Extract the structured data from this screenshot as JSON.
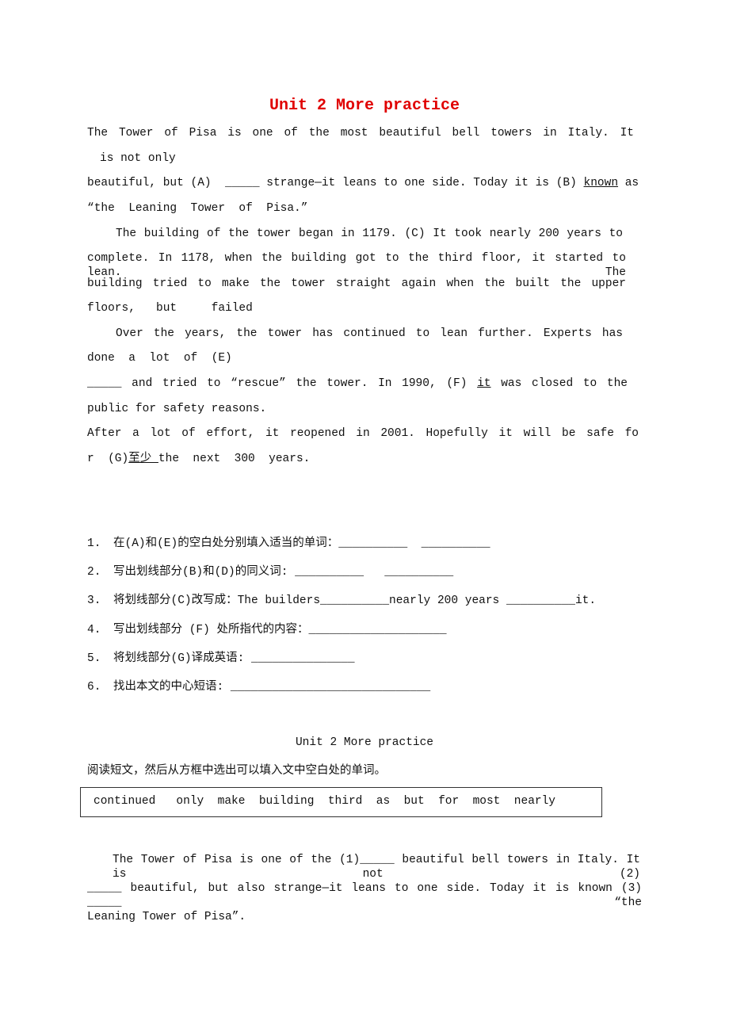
{
  "title": "Unit 2 More practice",
  "passage": [
    [
      {
        "t": "The Tower of Pisa is one of the most beautiful bell towers in Italy. It"
      }
    ],
    [
      {
        "t": "is not only"
      }
    ],
    [
      {
        "t": "beautiful, but (A)  "
      },
      {
        "t": "_____",
        "u": false
      },
      {
        "t": " strange—it leans to one side. Today it is (B) "
      },
      {
        "t": "known",
        "u": true
      },
      {
        "t": " as"
      }
    ],
    [
      {
        "t": "“the  Leaning  Tower  of  Pisa.”"
      }
    ],
    [
      {
        "t": "The building of the tower began in 1179. (C) It took nearly 200 years to"
      }
    ],
    [
      {
        "t": "complete. In 1178, when the building got to the third floor, it started to lean. The"
      }
    ],
    [
      {
        "t": "building tried to make the tower straight again when the built the upper"
      }
    ],
    [
      {
        "t": "floors,   but     failed"
      }
    ],
    [
      {
        "t": "Over the years, the tower has continued to lean further. Experts has"
      }
    ],
    [
      {
        "t": "done  a  lot  of  (E)"
      }
    ],
    [
      {
        "t": "_____     and  tried  to  “rescue”  the  tower.  In  1990,  (F)"
      },
      {
        "t": " it",
        "u": true
      },
      {
        "t": " was closed to the"
      }
    ],
    [
      {
        "t": "public for safety reasons."
      }
    ],
    [
      {
        "t": "After a lot of effort, it reopened in 2001. Hopefully it will be safe fo"
      }
    ],
    [
      {
        "t": "r  (G)"
      },
      {
        "t": "至少 ",
        "u": true
      },
      {
        "t": "the  next  300  years."
      }
    ]
  ],
  "questions": [
    {
      "num": "1.",
      "text": "在(A)和(E)的空白处分别填入适当的单词：__________  __________"
    },
    {
      "num": "2.",
      "text": "写出划线部分(B)和(D)的同义词: __________   __________"
    },
    {
      "num": "3.",
      "text": "将划线部分(C)改写成：The builders__________nearly 200 years __________it."
    },
    {
      "num": "4.",
      "text": "写出划线部分 (F) 处所指代的内容：____________________"
    },
    {
      "num": "5.",
      "text": "将划线部分(G)译成英语: _______________"
    },
    {
      "num": "6.",
      "text": "找出本文的中心短语: _____________________________"
    }
  ],
  "section2": {
    "title": "Unit 2 More practice",
    "instruction": "阅读短文，然后从方框中选出可以填入文中空白处的单词。",
    "word_box": "continued   only  make  building  third  as  but  for  most  nearly",
    "paragraph": [
      "The Tower of Pisa is one of the (1)_____ beautiful bell towers in Italy. It is not (2)",
      "_____ beautiful, but also strange—it leans to one side. Today it is known (3) _____ “the",
      "Leaning Tower of Pisa”."
    ]
  }
}
